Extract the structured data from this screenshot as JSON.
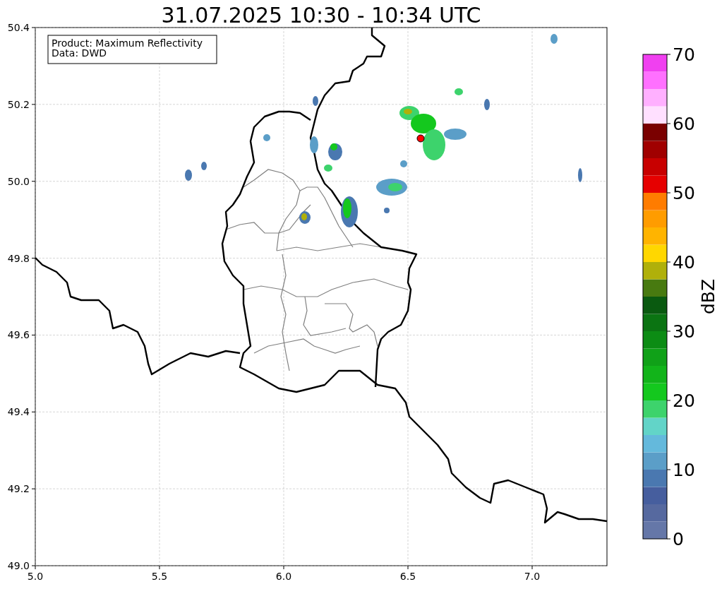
{
  "title": "31.07.2025 10:30 - 10:34 UTC",
  "info_box": [
    "Product: Maximum Reflectivity",
    "Data: DWD"
  ],
  "x_ticks": [
    "5.0",
    "5.5",
    "6.0",
    "6.5",
    "7.0"
  ],
  "y_ticks": [
    "50.4",
    "50.2",
    "50.0",
    "49.8",
    "49.6",
    "49.4",
    "49.2",
    "49.0"
  ],
  "colorbar": {
    "label": "dBZ",
    "ticks": [
      "70",
      "60",
      "50",
      "40",
      "30",
      "20",
      "10",
      "0"
    ],
    "colors": [
      {
        "color": "#6577a8"
      },
      {
        "color": "#56699f"
      },
      {
        "color": "#465e9e"
      },
      {
        "color": "#4a78b0"
      },
      {
        "color": "#5b9ec8"
      },
      {
        "color": "#64b9dc"
      },
      {
        "color": "#62d4c8"
      },
      {
        "color": "#3dd36c"
      },
      {
        "color": "#14c81e"
      },
      {
        "color": "#12b41a"
      },
      {
        "color": "#10a118"
      },
      {
        "color": "#0c8c14"
      },
      {
        "color": "#0b7412"
      },
      {
        "color": "#0a5a10"
      },
      {
        "color": "#487a10"
      },
      {
        "color": "#b0b00a"
      },
      {
        "color": "#ffd700"
      },
      {
        "color": "#ffb400"
      },
      {
        "color": "#ff9c00"
      },
      {
        "color": "#ff7c00"
      },
      {
        "color": "#e60000"
      },
      {
        "color": "#c80000"
      },
      {
        "color": "#a00000"
      },
      {
        "color": "#7a0000"
      },
      {
        "color": "#ffe0ff"
      },
      {
        "color": "#ffb0ff"
      },
      {
        "color": "#ff70ff"
      },
      {
        "color": "#f040f0"
      }
    ]
  }
}
